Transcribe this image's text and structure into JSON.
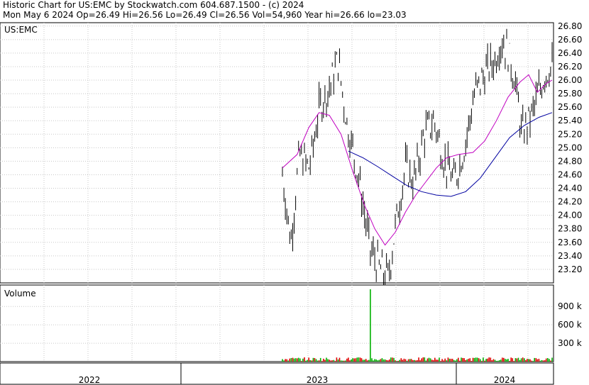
{
  "header": {
    "line1": "Historic Chart for US:EMC by Stockwatch.com 604.687.1500 - (c) 2024",
    "line2": "Mon May  6 2024   Op=26.49   Hi=26.56   Lo=26.49   Cl=26.56   Vol=54,960   Year hi=26.66   lo=23.03"
  },
  "chart_data": {
    "type": "line",
    "symbol": "US:EMC",
    "price_ylim": [
      23.0,
      26.85
    ],
    "price_ticks": [
      "26.80",
      "26.60",
      "26.40",
      "26.20",
      "26.00",
      "25.80",
      "25.60",
      "25.40",
      "25.20",
      "25.00",
      "24.80",
      "24.60",
      "24.40",
      "24.20",
      "24.00",
      "23.80",
      "23.60",
      "23.40",
      "23.20"
    ],
    "volume_label": "Volume",
    "volume_ticks": [
      "900 k",
      "600 k",
      "300 k"
    ],
    "x_labels": [
      "2022",
      "2023",
      "2024"
    ],
    "series": [
      {
        "name": "",
        "color": "#c000c0",
        "values": [
          [
            0,
            24.7
          ],
          [
            10,
            24.9
          ],
          [
            18,
            25.3
          ],
          [
            25,
            25.52
          ],
          [
            32,
            25.48
          ],
          [
            40,
            25.2
          ],
          [
            48,
            24.65
          ],
          [
            56,
            24.15
          ],
          [
            63,
            23.8
          ],
          [
            70,
            23.56
          ],
          [
            77,
            23.75
          ],
          [
            84,
            24.05
          ],
          [
            91,
            24.3
          ],
          [
            98,
            24.5
          ],
          [
            105,
            24.7
          ],
          [
            112,
            24.85
          ],
          [
            120,
            24.9
          ],
          [
            130,
            24.93
          ],
          [
            138,
            25.1
          ],
          [
            146,
            25.4
          ],
          [
            154,
            25.75
          ],
          [
            162,
            25.97
          ],
          [
            168,
            26.08
          ],
          [
            174,
            25.82
          ],
          [
            180,
            25.95
          ],
          [
            184,
            26.0
          ]
        ]
      },
      {
        "name": "",
        "color": "#0000a0",
        "values": [
          [
            45,
            24.95
          ],
          [
            55,
            24.85
          ],
          [
            65,
            24.72
          ],
          [
            75,
            24.58
          ],
          [
            85,
            24.44
          ],
          [
            95,
            24.35
          ],
          [
            105,
            24.3
          ],
          [
            115,
            24.28
          ],
          [
            125,
            24.35
          ],
          [
            135,
            24.55
          ],
          [
            145,
            24.85
          ],
          [
            155,
            25.15
          ],
          [
            165,
            25.33
          ],
          [
            175,
            25.45
          ],
          [
            184,
            25.52
          ]
        ]
      }
    ],
    "volume_spike_k": 1180
  }
}
